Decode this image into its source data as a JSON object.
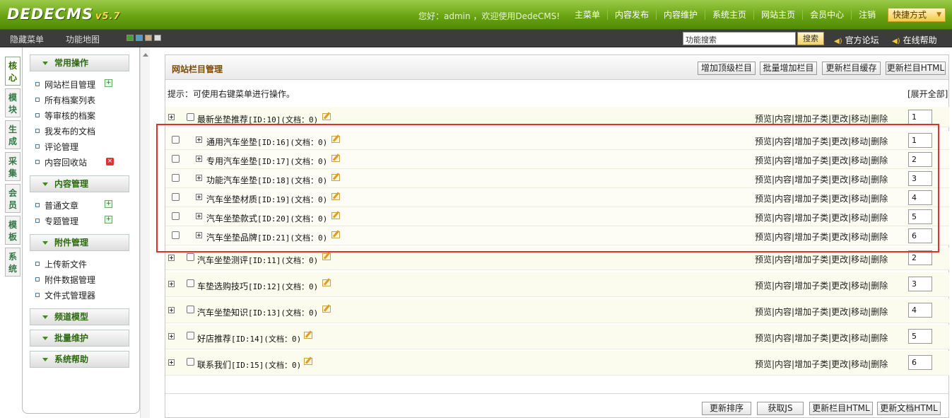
{
  "header": {
    "logo": "DEDECMS",
    "version": "v5.7",
    "welcome": "您好：admin ，欢迎使用DedeCMS!",
    "nav": [
      "主菜单",
      "内容发布",
      "内容维护",
      "系统主页",
      "网站主页",
      "会员中心",
      "注销"
    ],
    "quick": "快捷方式"
  },
  "subbar": {
    "hide_menu": "隐藏菜单",
    "site_map": "功能地图",
    "search_value": "功能搜索",
    "search_button": "搜索",
    "forum": "官方论坛",
    "help": "在线帮助",
    "swatches": [
      "#4aa02c",
      "#4c9ec9",
      "#c9b28a",
      "#dddddd"
    ]
  },
  "vtabs": [
    "核心",
    "模块",
    "生成",
    "采集",
    "会员",
    "模板",
    "系统"
  ],
  "sidebar": {
    "g1": "常用操作",
    "g1_items": [
      "网站栏目管理",
      "所有档案列表",
      "等审核的档案",
      "我发布的文档",
      "评论管理",
      "内容回收站"
    ],
    "g2": "内容管理",
    "g2_items": [
      "普通文章",
      "专题管理"
    ],
    "g3": "附件管理",
    "g3_items": [
      "上传新文件",
      "附件数据管理",
      "文件式管理器"
    ],
    "g4": "频道模型",
    "g5": "批量维护",
    "g6": "系统帮助"
  },
  "main": {
    "title": "网站栏目管理",
    "buttons": [
      "增加顶级栏目",
      "批量增加栏目",
      "更新栏目缓存",
      "更新栏目HTML"
    ],
    "tip": "提示：可使用右键菜单进行操作。",
    "expand_all": "[展开全部]",
    "ops": "预览|内容|增加子类|更改|移动|删除",
    "top": {
      "name": "最新坐垫推荐",
      "meta": "[ID:10](文档：0)",
      "order": "1"
    },
    "children": [
      {
        "name": "通用汽车坐垫",
        "meta": "[ID:16](文档：0)",
        "order": "1"
      },
      {
        "name": "专用汽车坐垫",
        "meta": "[ID:17](文档：0)",
        "order": "2"
      },
      {
        "name": "功能汽车坐垫",
        "meta": "[ID:18](文档：0)",
        "order": "3"
      },
      {
        "name": "汽车坐垫材质",
        "meta": "[ID:19](文档：0)",
        "order": "4"
      },
      {
        "name": "汽车坐垫款式",
        "meta": "[ID:20](文档：0)",
        "order": "5"
      },
      {
        "name": "汽车坐垫品牌",
        "meta": "[ID:21](文档：0)",
        "order": "6"
      }
    ],
    "rest": [
      {
        "name": "汽车坐垫测评",
        "meta": "[ID:11](文档：0)",
        "order": "2"
      },
      {
        "name": "车垫选购技巧",
        "meta": "[ID:12](文档：0)",
        "order": "3"
      },
      {
        "name": "汽车坐垫知识",
        "meta": "[ID:13](文档：0)",
        "order": "4"
      },
      {
        "name": "好店推荐",
        "meta": "[ID:14](文档：0)",
        "order": "5"
      },
      {
        "name": "联系我们",
        "meta": "[ID:15](文档：0)",
        "order": "6"
      }
    ],
    "footer_buttons": [
      "更新排序",
      "获取JS",
      "更新栏目HTML",
      "更新文档HTML"
    ]
  },
  "highlight_color": "#e32f2f"
}
